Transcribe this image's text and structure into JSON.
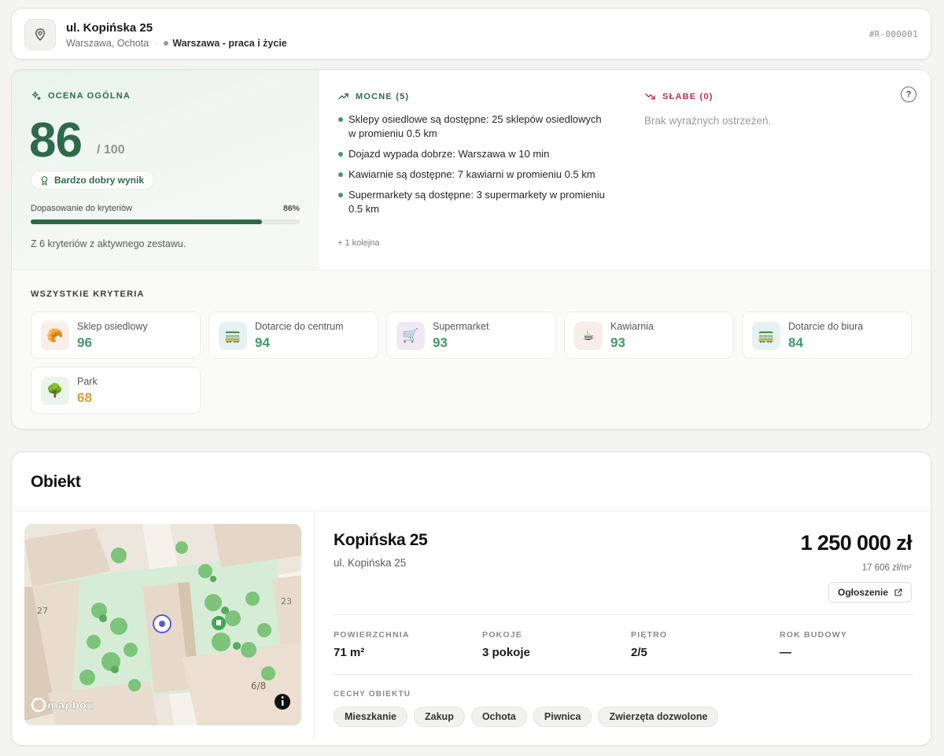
{
  "header": {
    "title": "ul. Kopińska 25",
    "location": "Warszawa, Ochota",
    "criteria_set": "Warszawa - praca i życie",
    "listing_id": "#R-000001"
  },
  "overall": {
    "heading": "OCENA OGÓLNA",
    "score": "86",
    "score_max": "/ 100",
    "result_label": "Bardzo dobry wynik",
    "fit_label": "Dopasowanie do kryteriów",
    "fit_percent_text": "86%",
    "fit_fraction": 0.86,
    "criteria_note": "Z 6 kryteriów z aktywnego zestawu."
  },
  "strong": {
    "heading": "MOCNE (5)",
    "items": [
      "Sklepy osiedlowe są dostępne: 25 sklepów osiedlowych w promieniu 0.5 km",
      "Dojazd wypada dobrze: Warszawa w 10 min",
      "Kawiarnie są dostępne: 7 kawiarni w promieniu 0.5 km",
      "Supermarkety są dostępne: 3 supermarkety w promieniu 0.5 km"
    ],
    "more": "+ 1 kolejna"
  },
  "weak": {
    "heading": "SŁABE (0)",
    "empty_text": "Brak wyraźnych ostrzeżeń."
  },
  "help_label": "?",
  "criteria": {
    "heading": "WSZYSTKIE KRYTERIA",
    "items": [
      {
        "name": "Sklep osiedlowy",
        "score": "96",
        "icon": "croissant-icon",
        "glyph": "🥐",
        "bg": "#fbeee8",
        "color": "#3d9b68"
      },
      {
        "name": "Dotarcie do centrum",
        "score": "94",
        "icon": "tram-icon",
        "glyph": "🚃",
        "bg": "#e6f1f3",
        "color": "#3d9b68"
      },
      {
        "name": "Supermarket",
        "score": "93",
        "icon": "shopping-cart-icon",
        "glyph": "🛒",
        "bg": "#efe9f6",
        "color": "#3d9b68"
      },
      {
        "name": "Kawiarnia",
        "score": "93",
        "icon": "coffee-icon",
        "glyph": "☕",
        "bg": "#f6ede6",
        "color": "#3d9b68"
      },
      {
        "name": "Dotarcie do biura",
        "score": "84",
        "icon": "tram-icon",
        "glyph": "🚃",
        "bg": "#e6f1f3",
        "color": "#3d9b68"
      },
      {
        "name": "Park",
        "score": "68",
        "icon": "tree-icon",
        "glyph": "🌳",
        "bg": "#eaf4ea",
        "color": "#e09a2e"
      }
    ]
  },
  "object": {
    "heading": "Obiekt",
    "map": {
      "label_left": "27",
      "label_right": "23",
      "label_bottom": "6/8",
      "attribution": "mapbox"
    },
    "name": "Kopińska 25",
    "address": "ul. Kopińska 25",
    "price": "1 250 000 zł",
    "price_per_sqm": "17 606 zł/m²",
    "listing_button": "Ogłoszenie",
    "specs": [
      {
        "label": "POWIERZCHNIA",
        "value": "71 m²"
      },
      {
        "label": "POKOJE",
        "value": "3 pokoje"
      },
      {
        "label": "PIĘTRO",
        "value": "2/5"
      },
      {
        "label": "ROK BUDOWY",
        "value": "—"
      }
    ],
    "features_heading": "CECHY OBIEKTU",
    "features": [
      "Mieszkanie",
      "Zakup",
      "Ochota",
      "Piwnica",
      "Zwierzęta dozwolone"
    ]
  }
}
